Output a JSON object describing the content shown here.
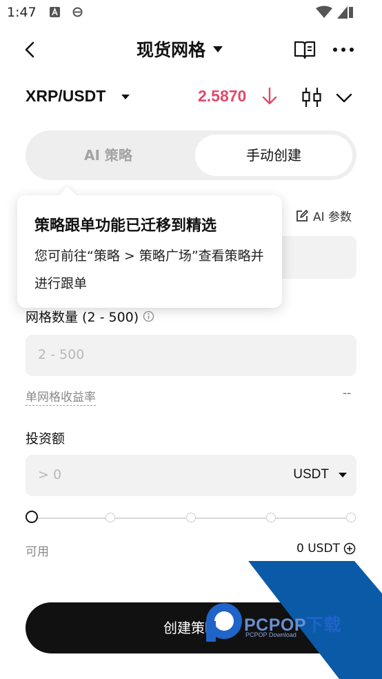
{
  "status_bar": {
    "time": "1:47"
  },
  "header": {
    "title": "现货网格"
  },
  "pair": {
    "symbol": "XRP/USDT",
    "price": "2.5870"
  },
  "mode_tabs": {
    "ai": "AI 策略",
    "manual": "手动创建",
    "selected": "manual"
  },
  "ai_params": {
    "label": "AI 参数"
  },
  "tooltip": {
    "title": "策略跟单功能已迁移到精选",
    "body": "您可前往“策略 > 策略广场”查看策略并进行跟单"
  },
  "grid_count": {
    "label": "网格数量 (2 - 500)",
    "placeholder": "2 - 500"
  },
  "grid_yield": {
    "label": "单网格收益率",
    "value": "--"
  },
  "investment": {
    "label": "投资额",
    "placeholder": "> 0",
    "currency": "USDT",
    "slider_fraction": 0
  },
  "available": {
    "label": "可用",
    "value": "0 USDT"
  },
  "create_button": {
    "label": "创建策略"
  },
  "watermark": {
    "brand": "PCPOP",
    "suffix": "下载",
    "sub": "PCPOP Download"
  },
  "colors": {
    "price_down": "#e04a6a",
    "primary": "#111111",
    "watermark": "#0b5aa8"
  }
}
